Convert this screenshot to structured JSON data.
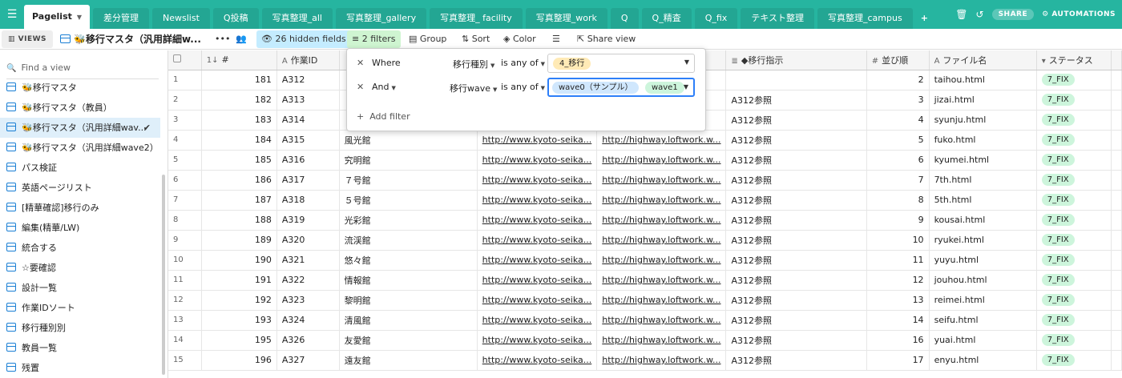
{
  "topbar": {
    "tabs": [
      {
        "label": "Pagelist",
        "active": true
      },
      {
        "label": "差分管理"
      },
      {
        "label": "Newslist"
      },
      {
        "label": "Q投稿"
      },
      {
        "label": "写真整理_all"
      },
      {
        "label": "写真整理_gallery"
      },
      {
        "label": "写真整理_ facility"
      },
      {
        "label": "写真整理_work"
      },
      {
        "label": "Q"
      },
      {
        "label": "Q_精査"
      },
      {
        "label": "Q_fix"
      },
      {
        "label": "テキスト整理"
      },
      {
        "label": "写真整理_campus"
      }
    ],
    "add_tab": "+",
    "share": "SHARE",
    "automations": "AUTOMATIONS"
  },
  "toolbar": {
    "views": "VIEWS",
    "view_name": "🐝移行マスタ（汎用詳細w...",
    "hidden_fields": "26 hidden fields",
    "filters": "2 filters",
    "group": "Group",
    "sort": "Sort",
    "color": "Color",
    "share_view": "Share view"
  },
  "sidebar": {
    "find_placeholder": "Find a view",
    "views": [
      "🐝移行マスタ",
      "🐝移行マスタ（教員）",
      "🐝移行マスタ（汎用詳細wav...",
      "🐝移行マスタ（汎用詳細wave2）",
      "パス検証",
      "英語ページリスト",
      "[精華確認]移行のみ",
      "編集(精華/LW)",
      "統合する",
      "☆要確認",
      "設計一覧",
      "作業IDソート",
      "移行種別別",
      "教員一覧",
      "残置"
    ],
    "active_index": 2
  },
  "grid": {
    "headers": [
      "",
      "#",
      "作業ID",
      "",
      "",
      "",
      "◆移行指示",
      "並び順",
      "ファイル名",
      "ステータス"
    ],
    "rows": [
      {
        "rn": "1",
        "no": "181",
        "id": "A312",
        "name": "",
        "u1": "",
        "u2": "",
        "sh": "",
        "ord": "2",
        "file": "taihou.html",
        "st": "7_FIX"
      },
      {
        "rn": "2",
        "no": "182",
        "id": "A313",
        "name": "",
        "u1": "",
        "u2": "",
        "sh": "A312参照",
        "ord": "3",
        "file": "jizai.html",
        "st": "7_FIX"
      },
      {
        "rn": "3",
        "no": "183",
        "id": "A314",
        "name": "",
        "u1": "",
        "u2": "",
        "sh": "A312参照",
        "ord": "4",
        "file": "syunju.html",
        "st": "7_FIX"
      },
      {
        "rn": "4",
        "no": "184",
        "id": "A315",
        "name": "風光館",
        "u1": "http://www.kyoto-seika...",
        "u2": "http://highway.loftwork.w...",
        "sh": "A312参照",
        "ord": "5",
        "file": "fuko.html",
        "st": "7_FIX"
      },
      {
        "rn": "5",
        "no": "185",
        "id": "A316",
        "name": "究明館",
        "u1": "http://www.kyoto-seika...",
        "u2": "http://highway.loftwork.w...",
        "sh": "A312参照",
        "ord": "6",
        "file": "kyumei.html",
        "st": "7_FIX"
      },
      {
        "rn": "6",
        "no": "186",
        "id": "A317",
        "name": "７号館",
        "u1": "http://www.kyoto-seika...",
        "u2": "http://highway.loftwork.w...",
        "sh": "A312参照",
        "ord": "7",
        "file": "7th.html",
        "st": "7_FIX"
      },
      {
        "rn": "7",
        "no": "187",
        "id": "A318",
        "name": "５号館",
        "u1": "http://www.kyoto-seika...",
        "u2": "http://highway.loftwork.w...",
        "sh": "A312参照",
        "ord": "8",
        "file": "5th.html",
        "st": "7_FIX"
      },
      {
        "rn": "8",
        "no": "188",
        "id": "A319",
        "name": "光彩館",
        "u1": "http://www.kyoto-seika...",
        "u2": "http://highway.loftwork.w...",
        "sh": "A312参照",
        "ord": "9",
        "file": "kousai.html",
        "st": "7_FIX"
      },
      {
        "rn": "9",
        "no": "189",
        "id": "A320",
        "name": "流渓館",
        "u1": "http://www.kyoto-seika...",
        "u2": "http://highway.loftwork.w...",
        "sh": "A312参照",
        "ord": "10",
        "file": "ryukei.html",
        "st": "7_FIX"
      },
      {
        "rn": "10",
        "no": "190",
        "id": "A321",
        "name": "悠々館",
        "u1": "http://www.kyoto-seika...",
        "u2": "http://highway.loftwork.w...",
        "sh": "A312参照",
        "ord": "11",
        "file": "yuyu.html",
        "st": "7_FIX"
      },
      {
        "rn": "11",
        "no": "191",
        "id": "A322",
        "name": "情報館",
        "u1": "http://www.kyoto-seika...",
        "u2": "http://highway.loftwork.w...",
        "sh": "A312参照",
        "ord": "12",
        "file": "jouhou.html",
        "st": "7_FIX"
      },
      {
        "rn": "12",
        "no": "192",
        "id": "A323",
        "name": "黎明館",
        "u1": "http://www.kyoto-seika...",
        "u2": "http://highway.loftwork.w...",
        "sh": "A312参照",
        "ord": "13",
        "file": "reimei.html",
        "st": "7_FIX"
      },
      {
        "rn": "13",
        "no": "193",
        "id": "A324",
        "name": "清風館",
        "u1": "http://www.kyoto-seika...",
        "u2": "http://highway.loftwork.w...",
        "sh": "A312参照",
        "ord": "14",
        "file": "seifu.html",
        "st": "7_FIX"
      },
      {
        "rn": "14",
        "no": "195",
        "id": "A326",
        "name": "友愛館",
        "u1": "http://www.kyoto-seika...",
        "u2": "http://highway.loftwork.w...",
        "sh": "A312参照",
        "ord": "16",
        "file": "yuai.html",
        "st": "7_FIX"
      },
      {
        "rn": "15",
        "no": "196",
        "id": "A327",
        "name": "遠友館",
        "u1": "http://www.kyoto-seika...",
        "u2": "http://highway.loftwork.w...",
        "sh": "A312参照",
        "ord": "17",
        "file": "enyu.html",
        "st": "7_FIX"
      }
    ]
  },
  "filter": {
    "row1": {
      "conj": "Where",
      "field": "移行種別",
      "op": "is any of",
      "values": [
        "4_移行"
      ]
    },
    "row2": {
      "conj": "And",
      "field": "移行wave",
      "op": "is any of",
      "values": [
        "wave0（サンプル）",
        "wave1"
      ]
    },
    "add_filter": "Add filter"
  },
  "colors": {
    "accent": "#26b5a0",
    "pill_green": "#cdf5dc",
    "pill_yellow": "#ffeab6",
    "pill_blue": "#d0e7fd",
    "focus": "#2d7ff9"
  }
}
